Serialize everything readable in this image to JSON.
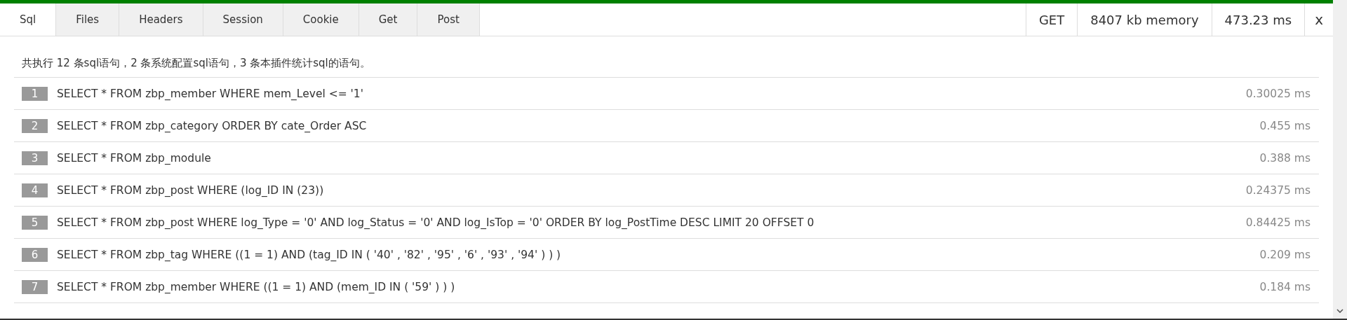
{
  "tabs": [
    {
      "label": "Sql",
      "selected": true
    },
    {
      "label": "Files",
      "selected": false
    },
    {
      "label": "Headers",
      "selected": false
    },
    {
      "label": "Session",
      "selected": false
    },
    {
      "label": "Cookie",
      "selected": false
    },
    {
      "label": "Get",
      "selected": false
    },
    {
      "label": "Post",
      "selected": false
    }
  ],
  "stats": [
    "GET",
    "8407 kb memory",
    "473.23 ms"
  ],
  "close": "x",
  "summary": "共执行 12 条sql语句，2 条系统配置sql语句，3 条本插件统计sql的语句。",
  "queries": [
    {
      "index": "1",
      "sql": "SELECT * FROM zbp_member WHERE mem_Level <= '1'",
      "time": "0.30025 ms"
    },
    {
      "index": "2",
      "sql": "SELECT * FROM zbp_category ORDER BY cate_Order ASC",
      "time": "0.455 ms"
    },
    {
      "index": "3",
      "sql": "SELECT * FROM zbp_module",
      "time": "0.388 ms"
    },
    {
      "index": "4",
      "sql": "SELECT * FROM zbp_post WHERE (log_ID IN (23))",
      "time": "0.24375 ms"
    },
    {
      "index": "5",
      "sql": "SELECT * FROM zbp_post WHERE log_Type = '0' AND log_Status = '0' AND log_IsTop = '0' ORDER BY log_PostTime DESC LIMIT 20 OFFSET 0",
      "time": "0.84425 ms"
    },
    {
      "index": "6",
      "sql": "SELECT * FROM zbp_tag WHERE ((1 = 1) AND (tag_ID IN ( '40' , '82' , '95' , '6' , '93' , '94' ) ) )",
      "time": "0.209 ms"
    },
    {
      "index": "7",
      "sql": "SELECT * FROM zbp_member WHERE ((1 = 1) AND (mem_ID IN ( '59' ) ) )",
      "time": "0.184 ms"
    }
  ]
}
